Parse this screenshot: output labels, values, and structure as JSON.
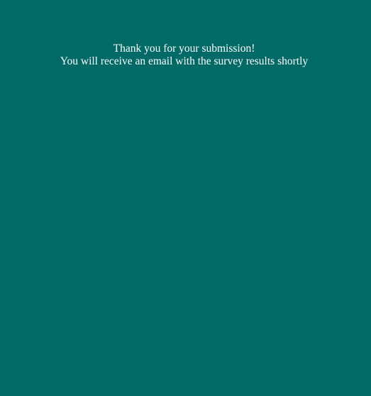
{
  "theme": {
    "background": "#016966",
    "text_color": "#ffffff"
  },
  "confirmation": {
    "line1": "Thank you for your submission!",
    "line2": "You will receive an email with the survey results shortly"
  }
}
